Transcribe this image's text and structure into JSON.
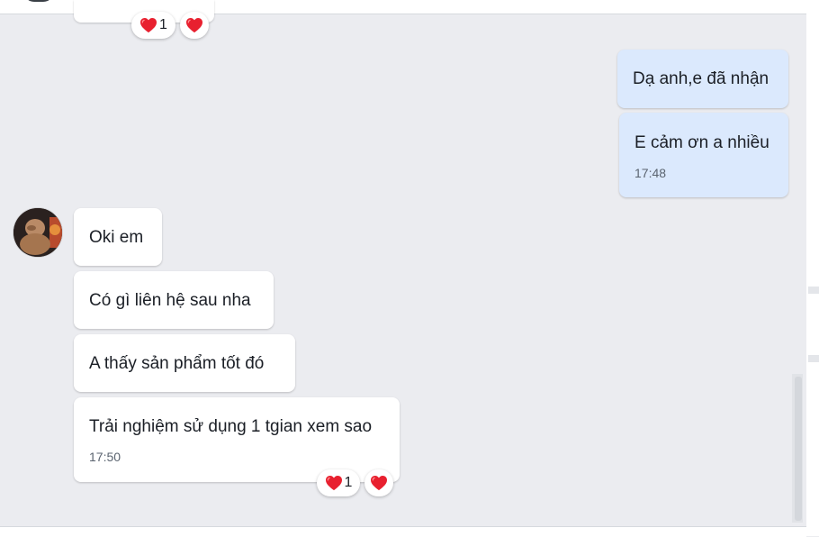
{
  "previous_message": {
    "reactions": [
      {
        "emoji": "heart",
        "count": "1"
      },
      {
        "emoji": "heart",
        "count": ""
      }
    ]
  },
  "outgoing": [
    {
      "text": "Dạ anh,e đã nhận",
      "time": ""
    },
    {
      "text": "E cảm ơn a nhiều",
      "time": "17:48"
    }
  ],
  "incoming": [
    {
      "text": "Oki em",
      "time": ""
    },
    {
      "text": "Có gì liên hệ sau nha",
      "time": ""
    },
    {
      "text": "A thấy sản phẩm tốt đó",
      "time": ""
    },
    {
      "text": "Trải nghiệm sử dụng 1 tgian xem sao",
      "time": "17:50"
    }
  ],
  "last_message_reactions": [
    {
      "emoji": "heart",
      "count": "1"
    },
    {
      "emoji": "heart",
      "count": ""
    }
  ],
  "colors": {
    "background": "#ebecf0",
    "incoming_bubble": "#ffffff",
    "outgoing_bubble": "#dbe9fd",
    "heart": "#e8202f",
    "timestamp": "#5b6470"
  }
}
